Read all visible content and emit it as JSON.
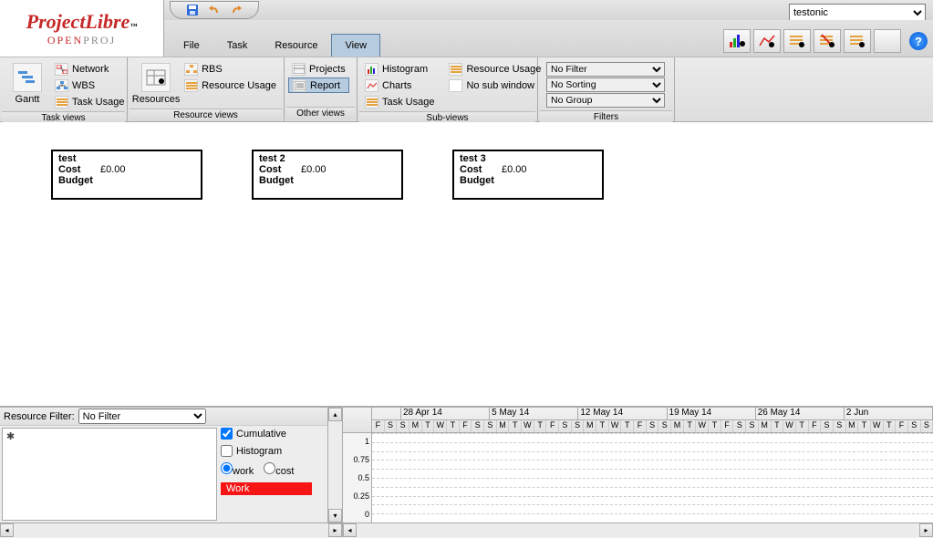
{
  "logo": {
    "main": "ProjectLibre",
    "tm": "™",
    "sub_open": "OPEN",
    "sub_proj": "PROJ"
  },
  "project_dropdown": "testonic",
  "menu": {
    "file": "File",
    "task": "Task",
    "resource": "Resource",
    "view": "View"
  },
  "ribbon": {
    "task_views": {
      "title": "Task views",
      "gantt": "Gantt",
      "network": "Network",
      "wbs": "WBS",
      "task_usage": "Task Usage"
    },
    "resource_views": {
      "title": "Resource views",
      "resources": "Resources",
      "rbs": "RBS",
      "resource_usage": "Resource Usage"
    },
    "other_views": {
      "title": "Other views",
      "projects": "Projects",
      "report": "Report"
    },
    "sub_views": {
      "title": "Sub-views",
      "histogram": "Histogram",
      "charts": "Charts",
      "task_usage": "Task Usage",
      "resource_usage": "Resource Usage",
      "no_sub_window": "No sub window"
    },
    "filters": {
      "title": "Filters",
      "no_filter": "No Filter",
      "no_sorting": "No Sorting",
      "no_group": "No Group"
    }
  },
  "tasks": [
    {
      "name": "test",
      "cost_label": "Cost",
      "cost_value": "£0.00",
      "budget_label": "Budget"
    },
    {
      "name": "test 2",
      "cost_label": "Cost",
      "cost_value": "£0.00",
      "budget_label": "Budget"
    },
    {
      "name": "test 3",
      "cost_label": "Cost",
      "cost_value": "£0.00",
      "budget_label": "Budget"
    }
  ],
  "bottom": {
    "resource_filter_label": "Resource Filter:",
    "resource_filter_value": "No Filter",
    "cumulative": "Cumulative",
    "histogram": "Histogram",
    "work": "work",
    "cost": "cost",
    "work_box": "Work",
    "list_indicator": "✱"
  },
  "chart_data": {
    "type": "bar",
    "title": "",
    "xlabel": "",
    "ylabel": "",
    "ylim": [
      0,
      1
    ],
    "yticks": [
      0,
      0.25,
      0.5,
      0.75,
      1
    ],
    "weeks": [
      "28 Apr 14",
      "5 May 14",
      "12 May 14",
      "19 May 14",
      "26 May 14",
      "2 Jun"
    ],
    "leading_days": [
      "F",
      "S",
      "S"
    ],
    "day_pattern": [
      "M",
      "T",
      "W",
      "T",
      "F",
      "S",
      "S"
    ],
    "series": [
      {
        "name": "Work",
        "values": []
      }
    ]
  }
}
